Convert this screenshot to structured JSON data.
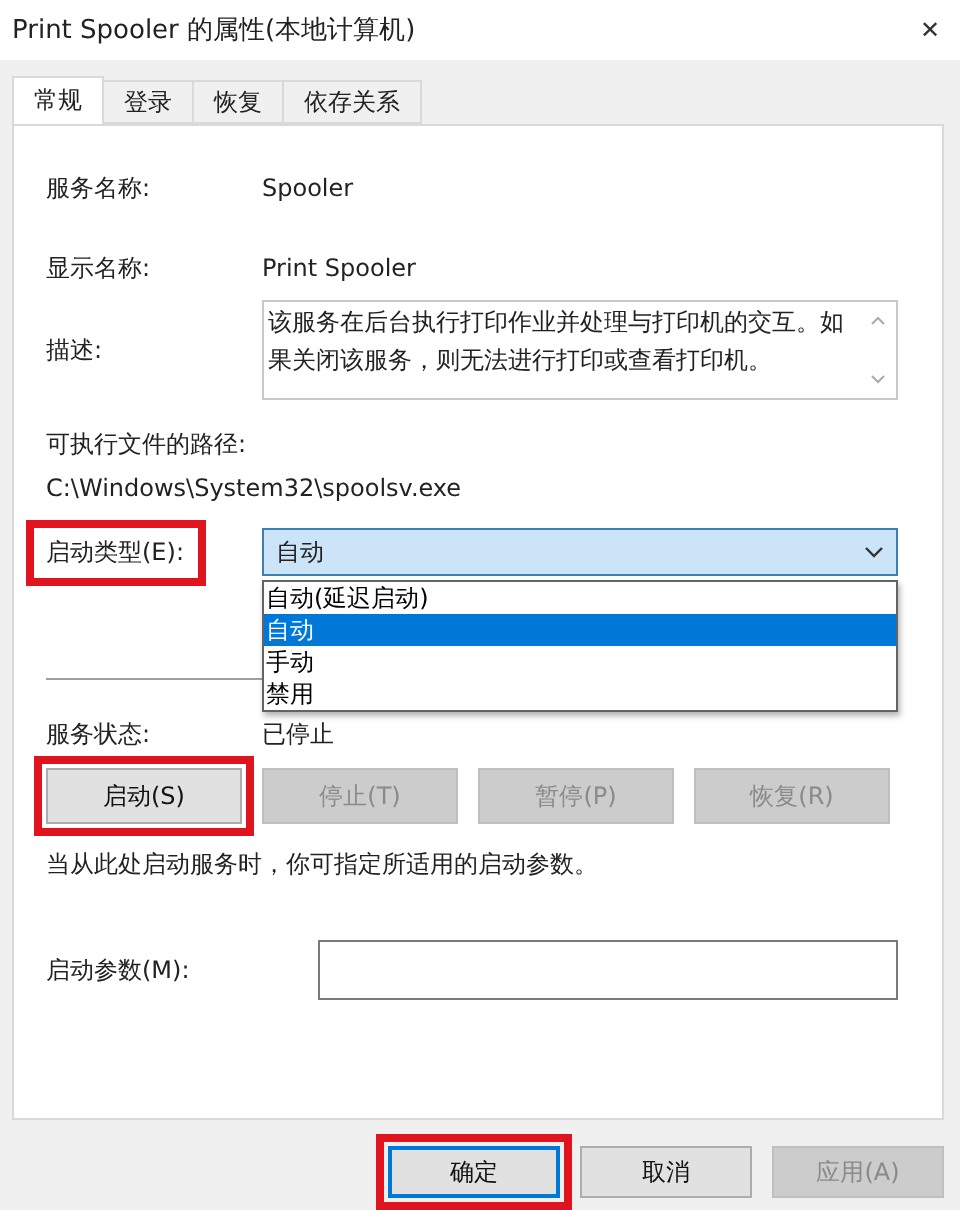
{
  "window": {
    "title": "Print Spooler 的属性(本地计算机)",
    "close": "✕"
  },
  "tabs": [
    {
      "label": "常规",
      "selected": true
    },
    {
      "label": "登录",
      "selected": false
    },
    {
      "label": "恢复",
      "selected": false
    },
    {
      "label": "依存关系",
      "selected": false
    }
  ],
  "service_name": {
    "label": "服务名称:",
    "value": "Spooler"
  },
  "display_name": {
    "label": "显示名称:",
    "value": "Print Spooler"
  },
  "description": {
    "label": "描述:",
    "value": "该服务在后台执行打印作业并处理与打印机的交互。如果关闭该服务，则无法进行打印或查看打印机。"
  },
  "executable": {
    "label": "可执行文件的路径:",
    "value": "C:\\Windows\\System32\\spoolsv.exe"
  },
  "startup_type": {
    "label": "启动类型(E):",
    "highlighted": true,
    "value": "自动",
    "expanded": true,
    "options": [
      {
        "label": "自动(延迟启动)",
        "selected": false
      },
      {
        "label": "自动",
        "selected": true
      },
      {
        "label": "手动",
        "selected": false
      },
      {
        "label": "禁用",
        "selected": false
      }
    ]
  },
  "service_status": {
    "label": "服务状态:",
    "value": "已停止"
  },
  "service_buttons": [
    {
      "label": "启动(S)",
      "disabled": false,
      "highlighted": true
    },
    {
      "label": "停止(T)",
      "disabled": true,
      "highlighted": false
    },
    {
      "label": "暂停(P)",
      "disabled": true,
      "highlighted": false
    },
    {
      "label": "恢复(R)",
      "disabled": true,
      "highlighted": false
    }
  ],
  "hint": "当从此处启动服务时，你可指定所适用的启动参数。",
  "start_parameters": {
    "label": "启动参数(M):"
  },
  "dialog_buttons": [
    {
      "label": "确定",
      "default": true,
      "disabled": false,
      "highlighted": true
    },
    {
      "label": "取消",
      "default": false,
      "disabled": false,
      "highlighted": false
    },
    {
      "label": "应用(A)",
      "default": false,
      "disabled": true,
      "highlighted": false
    }
  ]
}
